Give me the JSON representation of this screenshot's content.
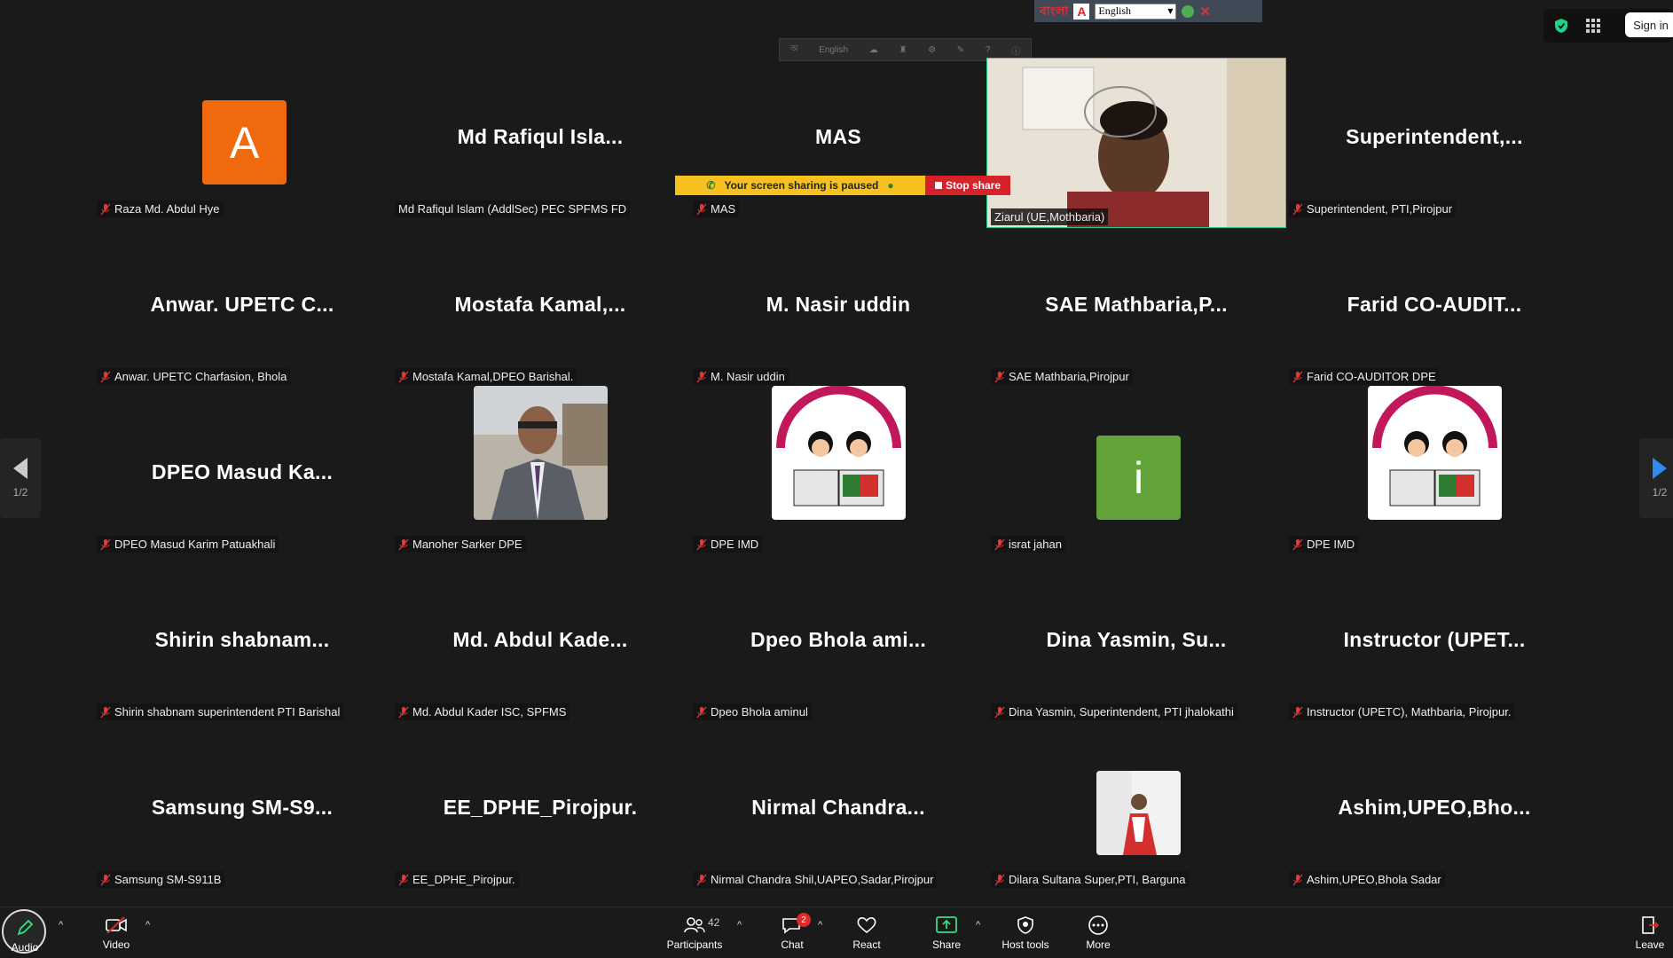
{
  "ime_bar": {
    "label": "বাংলা",
    "a": "A",
    "language": "English"
  },
  "share_toolbar": {
    "language": "English"
  },
  "top_right": {
    "sign_in": "Sign in"
  },
  "page_indicator": "1/2",
  "screen_share": {
    "paused_text": "Your screen sharing is paused",
    "stop_label": "Stop share"
  },
  "tiles": [
    {
      "name": "",
      "label": "Raza Md. Abdul Hye",
      "avatar": "A"
    },
    {
      "name": "Md Rafiqul Isla...",
      "label": "Md Rafiqul Islam (AddlSec) PEC SPFMS FD"
    },
    {
      "name": "MAS",
      "label": "MAS"
    },
    {
      "name": "",
      "label": "Ziarul (UE,Mothbaria)"
    },
    {
      "name": "Superintendent,...",
      "label": "Superintendent, PTI,Pirojpur"
    },
    {
      "name": "Anwar. UPETC C...",
      "label": "Anwar. UPETC Charfasion, Bhola"
    },
    {
      "name": "Mostafa  Kamal,...",
      "label": "Mostafa Kamal,DPEO Barishal."
    },
    {
      "name": "M. Nasir uddin",
      "label": "M. Nasir uddin"
    },
    {
      "name": "SAE  Mathbaria,P...",
      "label": "SAE Mathbaria,Pirojpur"
    },
    {
      "name": "Farid  CO-AUDIT...",
      "label": "Farid CO-AUDITOR DPE"
    },
    {
      "name": "DPEO  Masud  Ka...",
      "label": "DPEO Masud Karim Patuakhali"
    },
    {
      "name": "",
      "label": "Manoher Sarker DPE"
    },
    {
      "name": "",
      "label": "DPE IMD"
    },
    {
      "name": "",
      "label": "israt jahan",
      "avatar": "i"
    },
    {
      "name": "",
      "label": "DPE IMD"
    },
    {
      "name": "Shirin  shabnam...",
      "label": "Shirin shabnam superintendent PTI  Barishal"
    },
    {
      "name": "Md.  Abdul  Kade...",
      "label": "Md. Abdul Kader ISC, SPFMS"
    },
    {
      "name": "Dpeo  Bhola  ami...",
      "label": "Dpeo Bhola aminul"
    },
    {
      "name": "Dina  Yasmin,  Su...",
      "label": "Dina Yasmin, Superintendent, PTI jhalokathi"
    },
    {
      "name": "Instructor  (UPET...",
      "label": "Instructor (UPETC), Mathbaria, Pirojpur."
    },
    {
      "name": "Samsung  SM-S9...",
      "label": "Samsung SM-S911B"
    },
    {
      "name": "EE_DPHE_Pirojpur.",
      "label": "EE_DPHE_Pirojpur."
    },
    {
      "name": "Nirmal  Chandra...",
      "label": "Nirmal Chandra Shil,UAPEO,Sadar,Pirojpur"
    },
    {
      "name": "",
      "label": "Dilara Sultana Super,PTI, Barguna"
    },
    {
      "name": "Ashim,UPEO,Bho...",
      "label": "Ashim,UPEO,Bhola Sadar"
    }
  ],
  "toolbar": {
    "audio": "Audio",
    "video": "Video",
    "participants": "Participants",
    "participants_count": "42",
    "chat": "Chat",
    "chat_badge": "2",
    "react": "React",
    "share": "Share",
    "host_tools": "Host tools",
    "more": "More",
    "leave": "Leave"
  }
}
